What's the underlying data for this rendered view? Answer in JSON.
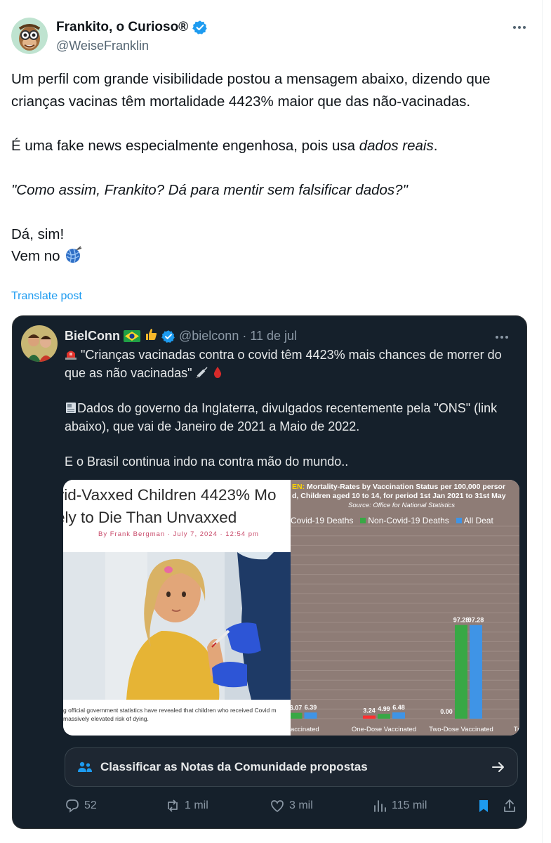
{
  "author": {
    "name": "Frankito, o Curioso®",
    "handle": "@WeiseFranklin"
  },
  "post": {
    "p1": "Um perfil com grande visibilidade postou a mensagem abaixo, dizendo que crianças vacinas têm mortalidade 4423% maior que das não-vacinadas.",
    "p2_start": "É uma fake news especialmente engenhosa, pois usa ",
    "p2_emph": "dados reais",
    "p2_end": ".",
    "p3": "\"Como assim, Frankito? Dá para mentir sem falsificar dados?\"",
    "p4": "Dá, sim!",
    "p5": "Vem no"
  },
  "translate_label": "Translate post",
  "quoted": {
    "name": "BielConn",
    "handle": "@bielconn",
    "separator": "·",
    "date": "11 de jul",
    "line1": "\"Crianças vacinadas contra o covid têm 4423% mais chances de morrer do que as não vacinadas\"",
    "line2": "Dados do governo da Inglaterra, divulgados recentemente pela \"ONS\" (link abaixo), que vai de Janeiro de 2021 a Maio de 2022.",
    "line3": "E o Brasil continua indo na contra mão do mundo..",
    "article": {
      "title_1": "vid-Vaxxed Children 4423% Mo",
      "title_2": "ely to Die Than Unvaxxed",
      "byline": "By Frank Bergman · July 7, 2024 · 12:54 pm",
      "caption_1": "g official government statistics have revealed that children who received Covid m",
      "caption_2": "massively elevated risk of dying."
    }
  },
  "chart_data": {
    "type": "bar",
    "title_prefix": "EN:",
    "title": "Mortality-Rates by Vaccination Status per 100,000 persor",
    "subtitle": "d, Children aged 10 to 14, for period 1st Jan 2021 to 31st May",
    "source": "Source: Office for National Statistics",
    "legend": [
      "Covid-19 Deaths",
      "Non-Covid-19 Deaths",
      "All Deat"
    ],
    "categories": [
      "accinated",
      "One-Dose Vaccinated",
      "Two-Dose Vaccinated",
      "Tr"
    ],
    "series": [
      {
        "name": "Covid-19 Deaths",
        "color": "#ff3030",
        "values": [
          null,
          3.24,
          0.0,
          null
        ]
      },
      {
        "name": "Non-Covid-19 Deaths",
        "color": "#38a845",
        "values": [
          6.07,
          4.99,
          97.28,
          null
        ]
      },
      {
        "name": "All Deat",
        "color": "#3f94e6",
        "values": [
          6.39,
          6.48,
          97.28,
          null
        ]
      }
    ],
    "ylim": [
      0,
      200
    ],
    "grid": true
  },
  "community_notes_label": "Classificar as Notas da Comunidade propostas",
  "actions": {
    "replies": "52",
    "reposts": "1 mil",
    "likes": "3 mil",
    "views": "115 mil"
  },
  "colors": {
    "accent": "#1d9bf0",
    "card_bg": "#15202b"
  }
}
